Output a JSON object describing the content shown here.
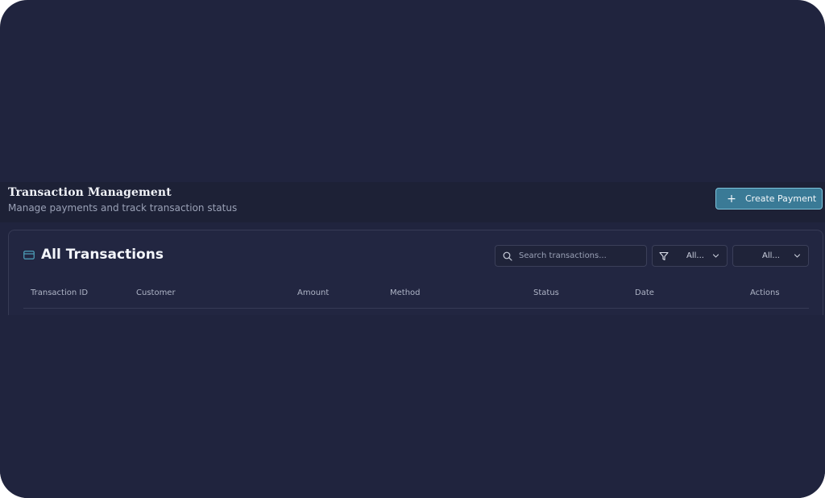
{
  "header": {
    "title": "Transaction Management",
    "subtitle": "Manage payments and track transaction status",
    "create_button_label": "Create Payment"
  },
  "card": {
    "title": "All Transactions",
    "icon": "credit-card-icon",
    "search": {
      "placeholder": "Search transactions...",
      "value": ""
    },
    "filters": [
      {
        "icon": "filter-icon",
        "value": "All..."
      },
      {
        "value": "All..."
      }
    ],
    "table": {
      "columns": [
        "Transaction ID",
        "Customer",
        "Amount",
        "Method",
        "Status",
        "Date",
        "Actions"
      ]
    }
  },
  "colors": {
    "background": "#20243e",
    "accent": "#3a7a96",
    "accent_border": "#7ec3da"
  }
}
